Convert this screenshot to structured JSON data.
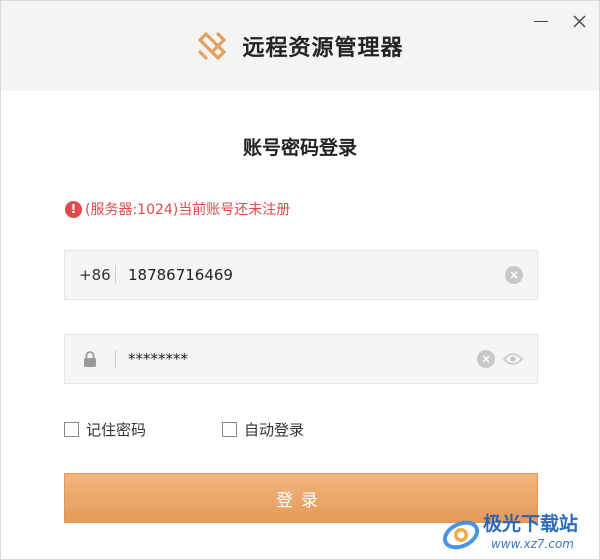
{
  "window": {
    "app_title": "远程资源管理器",
    "brand_color": "#e4a05f"
  },
  "login": {
    "heading": "账号密码登录",
    "error_message": "(服务器:1024)当前账号还未注册",
    "error_color": "#e04a4a"
  },
  "phone": {
    "prefix": "+86",
    "value": "18786716469"
  },
  "password": {
    "value": "********"
  },
  "options": {
    "remember_label": "记住密码",
    "remember_checked": false,
    "auto_login_label": "自动登录",
    "auto_login_checked": false
  },
  "submit": {
    "label": "登录"
  },
  "watermark": {
    "name": "极光下载站",
    "url": "www.xz7.com"
  },
  "icons": {
    "minimize": "minimize-icon",
    "close": "close-icon",
    "logo": "app-logo-icon",
    "error": "error-icon",
    "lock": "lock-icon",
    "clear": "clear-icon",
    "eye": "eye-icon"
  }
}
